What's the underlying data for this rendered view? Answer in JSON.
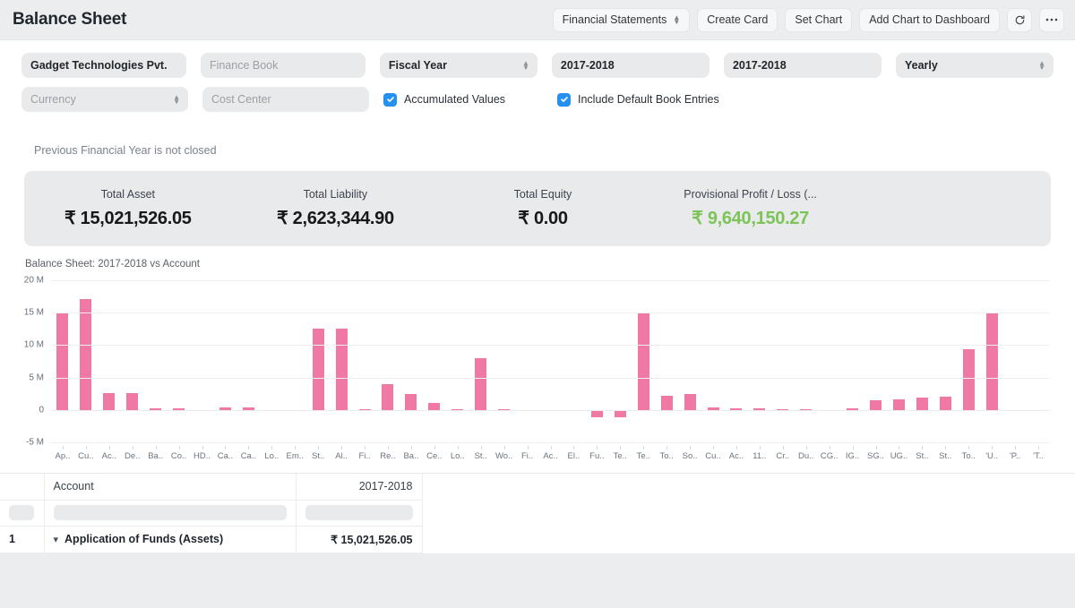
{
  "header": {
    "title": "Balance Sheet",
    "actions": [
      {
        "label": "Financial Statements",
        "type": "select"
      },
      {
        "label": "Create Card",
        "type": "button"
      },
      {
        "label": "Set Chart",
        "type": "button"
      },
      {
        "label": "Add Chart to Dashboard",
        "type": "button"
      }
    ],
    "refresh_icon": "refresh-icon",
    "more_icon": "ellipsis-icon"
  },
  "filters": {
    "row1": [
      {
        "name": "company",
        "value": "Gadget Technologies Pvt.",
        "placeholder": "",
        "caret": false
      },
      {
        "name": "finance-book",
        "value": "",
        "placeholder": "Finance Book",
        "caret": false
      },
      {
        "name": "period-basis",
        "value": "Fiscal Year",
        "placeholder": "",
        "caret": true
      },
      {
        "name": "from-fiscal-year",
        "value": "2017-2018",
        "placeholder": "",
        "caret": false
      },
      {
        "name": "to-fiscal-year",
        "value": "2017-2018",
        "placeholder": "",
        "caret": false
      },
      {
        "name": "periodicity",
        "value": "Yearly",
        "placeholder": "",
        "caret": true
      }
    ],
    "row2": [
      {
        "name": "currency",
        "value": "",
        "placeholder": "Currency",
        "caret": true
      },
      {
        "name": "cost-center",
        "value": "",
        "placeholder": "Cost Center",
        "caret": false
      }
    ],
    "checkboxes": [
      {
        "name": "accumulated-values",
        "label": "Accumulated Values",
        "checked": true
      },
      {
        "name": "include-default-book-entries",
        "label": "Include Default Book Entries",
        "checked": true
      }
    ]
  },
  "notice": "Previous Financial Year is not closed",
  "summary": [
    {
      "label": "Total Asset",
      "value": "₹ 15,021,526.05",
      "color": "#16191c"
    },
    {
      "label": "Total Liability",
      "value": "₹ 2,623,344.90",
      "color": "#16191c"
    },
    {
      "label": "Total Equity",
      "value": "₹ 0.00",
      "color": "#16191c"
    },
    {
      "label": "Provisional Profit / Loss (...",
      "value": "₹ 9,640,150.27",
      "color": "#7cc457"
    }
  ],
  "chart_data": {
    "type": "bar",
    "title": "Balance Sheet: 2017-2018 vs Account",
    "xlabel": "Account",
    "ylabel": "",
    "ylim": [
      -5000000,
      20000000
    ],
    "ytick_labels": [
      "20 M",
      "15 M",
      "10 M",
      "5 M",
      "0",
      "-5 M"
    ],
    "ytick_values": [
      20000000,
      15000000,
      10000000,
      5000000,
      0,
      -5000000
    ],
    "grid": true,
    "legend": null,
    "bar_color": "#ef78a5",
    "series": [
      {
        "name": "2017-2018",
        "values": [
          15021526,
          17080000,
          2650000,
          2620000,
          290000,
          290000,
          0,
          340000,
          340000,
          0,
          0,
          12600000,
          12600000,
          150000,
          4020000,
          2400000,
          1100000,
          160000,
          8000000,
          130000,
          0,
          0,
          0,
          -1200000,
          -1200000,
          15000000,
          2170000,
          2400000,
          420000,
          180000,
          200000,
          130000,
          70000,
          0,
          180000,
          1450000,
          1600000,
          1900000,
          2050000,
          9400000,
          15000000
        ]
      }
    ],
    "categories": [
      "Ap..",
      "Cu..",
      "Ac..",
      "De..",
      "Ba..",
      "Co..",
      "HD..",
      "Ca..",
      "Ca..",
      "Lo..",
      "Em..",
      "St..",
      "Al..",
      "Fi..",
      "Re..",
      "Ba..",
      "Ce..",
      "Lo..",
      "St..",
      "Wo..",
      "Fi..",
      "Ac..",
      "El..",
      "Fu..",
      "Te..",
      "Te..",
      "To..",
      "So..",
      "Cu..",
      "Ac..",
      "11..",
      "Cr..",
      "Du..",
      "CG..",
      "IG..",
      "SG..",
      "UG..",
      "St..",
      "St..",
      "To..",
      "'U..",
      "'P..",
      "'T.."
    ]
  },
  "table": {
    "columns": [
      "",
      "Account",
      "2017-2018"
    ],
    "filter_row_placeholder": "",
    "rows": [
      {
        "index": "1",
        "account": "Application of Funds (Assets)",
        "value": "₹ 15,021,526.05",
        "expanded": true
      }
    ]
  }
}
